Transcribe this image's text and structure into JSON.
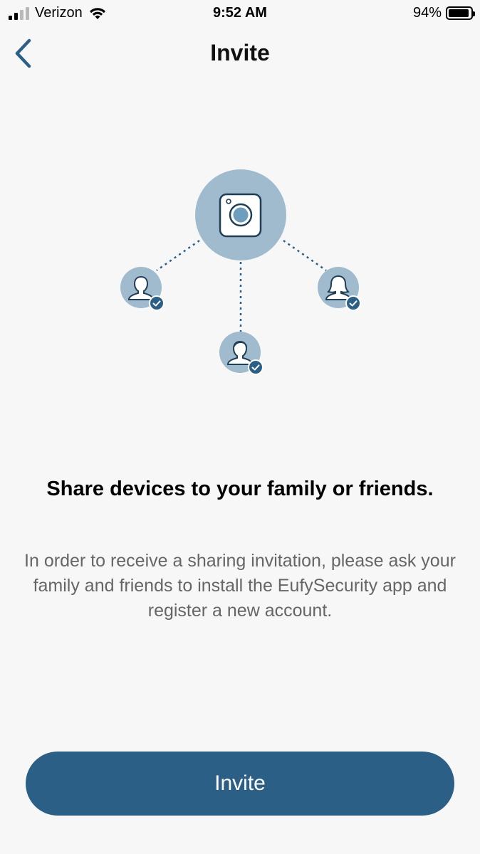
{
  "status_bar": {
    "carrier": "Verizon",
    "time": "9:52 AM",
    "battery_percent_label": "94%",
    "battery_level": 0.94
  },
  "nav": {
    "title": "Invite"
  },
  "content": {
    "headline": "Share devices to your family or friends.",
    "description": "In order to receive a sharing invitation, please ask your family and friends to install the EufySecurity app and register a new account."
  },
  "actions": {
    "invite_label": "Invite"
  },
  "colors": {
    "primary": "#2c5f86",
    "accent_light": "#a0bbce",
    "background": "#f7f7f7"
  }
}
